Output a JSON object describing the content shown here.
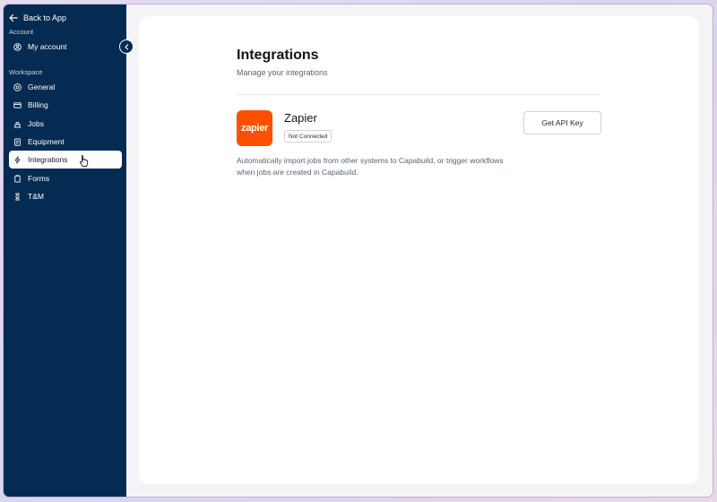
{
  "sidebar": {
    "back_label": "Back to App",
    "account_section": "Account",
    "account_items": [
      {
        "label": "My account",
        "icon": "user-circle-icon"
      }
    ],
    "workspace_section": "Workspace",
    "workspace_items": [
      {
        "label": "General",
        "icon": "globe-icon"
      },
      {
        "label": "Billing",
        "icon": "credit-card-icon"
      },
      {
        "label": "Jobs",
        "icon": "jobs-icon"
      },
      {
        "label": "Equipment",
        "icon": "clipboard-icon"
      },
      {
        "label": "Integrations",
        "icon": "lightning-icon",
        "active": true
      },
      {
        "label": "Forms",
        "icon": "form-icon"
      },
      {
        "label": "T&M",
        "icon": "hourglass-icon"
      }
    ]
  },
  "page": {
    "title": "Integrations",
    "subtitle": "Manage your integrations"
  },
  "integration": {
    "logo_text": "zapier",
    "name": "Zapier",
    "status": "Not Connected",
    "action_label": "Get API Key",
    "description": "Automatically import jobs from other systems to Capabuild, or trigger workflows when jobs are created in Capabuild."
  },
  "colors": {
    "sidebar_bg": "#062b52",
    "zapier_orange": "#ff4f00"
  }
}
